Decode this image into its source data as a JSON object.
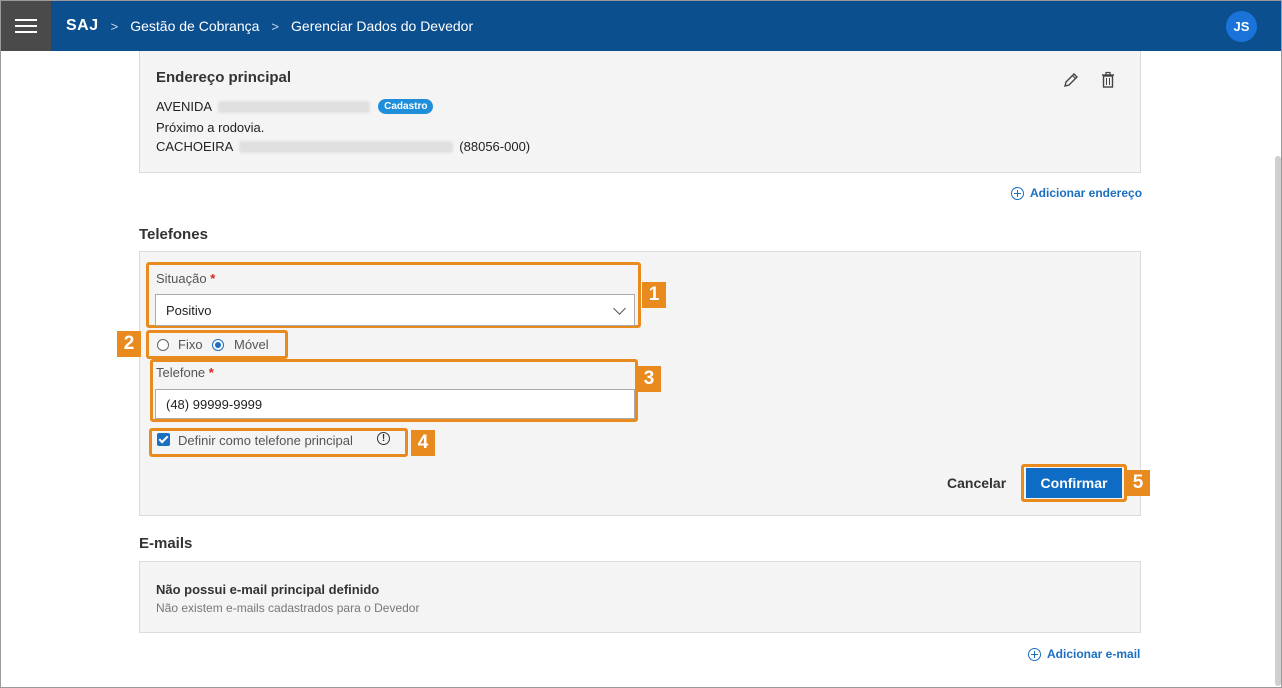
{
  "topbar": {
    "brand": "SAJ",
    "breadcrumb": [
      "Gestão de Cobrança",
      "Gerenciar Dados do Devedor"
    ],
    "separator": ">",
    "avatar": "JS"
  },
  "address": {
    "title": "Endereço principal",
    "line1_prefix": "AVENIDA",
    "badge": "Cadastro",
    "line2": "Próximo a rodovia.",
    "line3_prefix": "CACHOEIRA",
    "line3_suffix": "(88056-000)",
    "add_link": "Adicionar endereço"
  },
  "phones": {
    "section_title": "Telefones",
    "situacao_label": "Situação",
    "required_mark": "*",
    "situacao_value": "Positivo",
    "radio_fixo": "Fixo",
    "radio_movel": "Móvel",
    "selected_type": "Móvel",
    "telefone_label": "Telefone",
    "telefone_value": "(48) 99999-9999",
    "principal_label": "Definir como telefone principal",
    "principal_checked": true,
    "info_glyph": "!",
    "cancel": "Cancelar",
    "confirm": "Confirmar"
  },
  "callouts": [
    "1",
    "2",
    "3",
    "4",
    "5"
  ],
  "emails": {
    "section_title": "E-mails",
    "empty_title": "Não possui e-mail principal definido",
    "empty_sub": "Não existem e-mails cadastrados para o Devedor",
    "add_link": "Adicionar e-mail"
  },
  "colors": {
    "topbar": "#0c4f8f",
    "highlight": "#e88a1e",
    "primary": "#0f6cc4",
    "badge": "#1f8fdb"
  }
}
